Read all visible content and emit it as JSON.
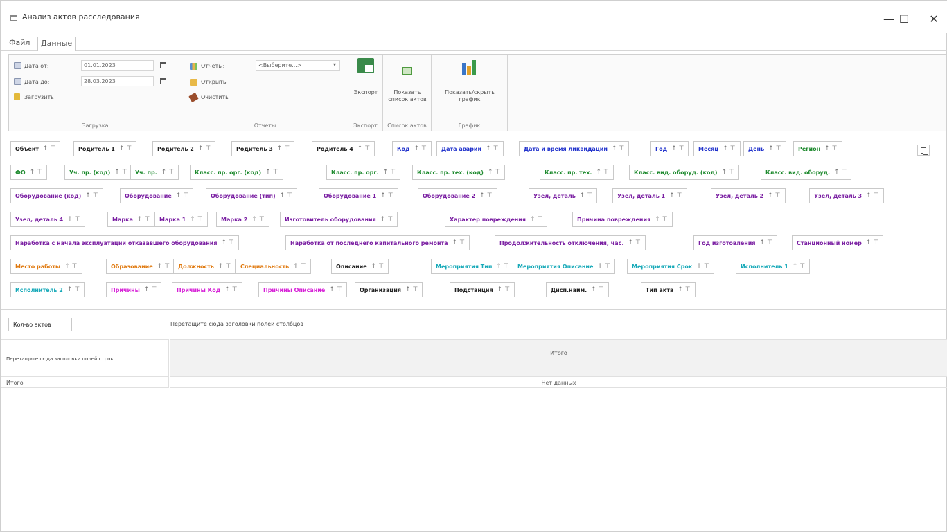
{
  "window": {
    "title": "Анализ актов расследования",
    "minimize": "—",
    "maximize": "☐",
    "close": "✕"
  },
  "menu": {
    "file": "Файл",
    "data": "Данные"
  },
  "ribbon": {
    "load": {
      "date_from_label": "Дата от:",
      "date_from_value": "01.01.2023",
      "date_to_label": "Дата до:",
      "date_to_value": "28.03.2023",
      "load_label": "Загрузить",
      "caption": "Загрузка"
    },
    "reports": {
      "reports_label": "Отчеты:",
      "select_value": "<Выберите...>",
      "open_label": "Открыть",
      "clear_label": "Очистить",
      "caption": "Отчеты"
    },
    "export": {
      "export_label": "Экспорт",
      "caption": "Экспорт"
    },
    "acts": {
      "show_line1": "Показать",
      "show_line2": "список актов",
      "caption": "Список актов"
    },
    "charts": {
      "toggle_line1": "Показать/скрыть",
      "toggle_line2": "график",
      "caption": "График"
    }
  },
  "fields": [
    {
      "label": "Объект",
      "color": "#222222"
    },
    {
      "label": "Родитель 1",
      "color": "#222222"
    },
    {
      "label": "Родитель 2",
      "color": "#222222"
    },
    {
      "label": "Родитель 3",
      "color": "#222222"
    },
    {
      "label": "Родитель 4",
      "color": "#222222"
    },
    {
      "label": "Код",
      "color": "#2233cc"
    },
    {
      "label": "Дата аварии",
      "color": "#2233cc"
    },
    {
      "label": "Дата и время ликвидации",
      "color": "#2233cc"
    },
    {
      "label": "Год",
      "color": "#2233cc"
    },
    {
      "label": "Месяц",
      "color": "#2233cc"
    },
    {
      "label": "День",
      "color": "#2233cc"
    },
    {
      "label": "Регион",
      "color": "#1e8a2e"
    },
    {
      "label": "ФО",
      "color": "#1e8a2e"
    },
    {
      "label": "Уч. пр. (код)",
      "color": "#1e8a2e"
    },
    {
      "label": "Уч. пр.",
      "color": "#1e8a2e"
    },
    {
      "label": "Класс. пр. орг. (код)",
      "color": "#1e8a2e"
    },
    {
      "label": "Класс. пр. орг.",
      "color": "#1e8a2e"
    },
    {
      "label": "Класс. пр. тех. (код)",
      "color": "#1e8a2e"
    },
    {
      "label": "Класс. пр. тех.",
      "color": "#1e8a2e"
    },
    {
      "label": "Класс. вид. оборуд. (код)",
      "color": "#1e8a2e"
    },
    {
      "label": "Класс. вид. оборуд.",
      "color": "#1e8a2e"
    },
    {
      "label": "Оборудование (код)",
      "color": "#7a1fa2"
    },
    {
      "label": "Оборудование",
      "color": "#7a1fa2"
    },
    {
      "label": "Оборудование (тип)",
      "color": "#7a1fa2"
    },
    {
      "label": "Оборудование 1",
      "color": "#7a1fa2"
    },
    {
      "label": "Оборудование 2",
      "color": "#7a1fa2"
    },
    {
      "label": "Узел, деталь",
      "color": "#7a1fa2"
    },
    {
      "label": "Узел, деталь 1",
      "color": "#7a1fa2"
    },
    {
      "label": "Узел, деталь 2",
      "color": "#7a1fa2"
    },
    {
      "label": "Узел, деталь 3",
      "color": "#7a1fa2"
    },
    {
      "label": "Узел, деталь 4",
      "color": "#7a1fa2"
    },
    {
      "label": "Марка",
      "color": "#7a1fa2"
    },
    {
      "label": "Марка 1",
      "color": "#7a1fa2"
    },
    {
      "label": "Марка 2",
      "color": "#7a1fa2"
    },
    {
      "label": "Изготовитель оборудования",
      "color": "#7a1fa2"
    },
    {
      "label": "Характер повреждения",
      "color": "#7a1fa2"
    },
    {
      "label": "Причина повреждения",
      "color": "#7a1fa2"
    },
    {
      "label": "Наработка с начала эксплуатации отказавшего оборудования",
      "color": "#7a1fa2"
    },
    {
      "label": "Наработка от последнего капитального ремонта",
      "color": "#7a1fa2"
    },
    {
      "label": "Продолжительность отключения, час.",
      "color": "#7a1fa2"
    },
    {
      "label": "Год изготовления",
      "color": "#7a1fa2"
    },
    {
      "label": "Станционный номер",
      "color": "#7a1fa2"
    },
    {
      "label": "Место работы",
      "color": "#e07a10"
    },
    {
      "label": "Образование",
      "color": "#e07a10"
    },
    {
      "label": "Должность",
      "color": "#e07a10"
    },
    {
      "label": "Специальность",
      "color": "#e07a10"
    },
    {
      "label": "Описание",
      "color": "#222222"
    },
    {
      "label": "Мероприятия Тип",
      "color": "#16a9b8"
    },
    {
      "label": "Мероприятия Описание",
      "color": "#16a9b8"
    },
    {
      "label": "Мероприятия Срок",
      "color": "#16a9b8"
    },
    {
      "label": "Исполнитель 1",
      "color": "#16a9b8"
    },
    {
      "label": "Исполнитель 2",
      "color": "#16a9b8"
    },
    {
      "label": "Причины",
      "color": "#d61fd6"
    },
    {
      "label": "Причины Код",
      "color": "#d61fd6"
    },
    {
      "label": "Причины Описание",
      "color": "#d61fd6"
    },
    {
      "label": "Организация",
      "color": "#222222"
    },
    {
      "label": "Подстанция",
      "color": "#222222"
    },
    {
      "label": "Дисп.наим.",
      "color": "#222222"
    },
    {
      "label": "Тип акта",
      "color": "#222222"
    }
  ],
  "sort_glyph": "↑",
  "filter_glyph": "⊤",
  "pivot": {
    "data_field": "Кол-во актов",
    "column_hint": "Перетащите сюда заголовки полей столбцов",
    "row_hint": "Перетащите сюда заголовки полей строк",
    "total_header": "Итого",
    "row_total": "Итого",
    "no_data": "Нет данных"
  }
}
